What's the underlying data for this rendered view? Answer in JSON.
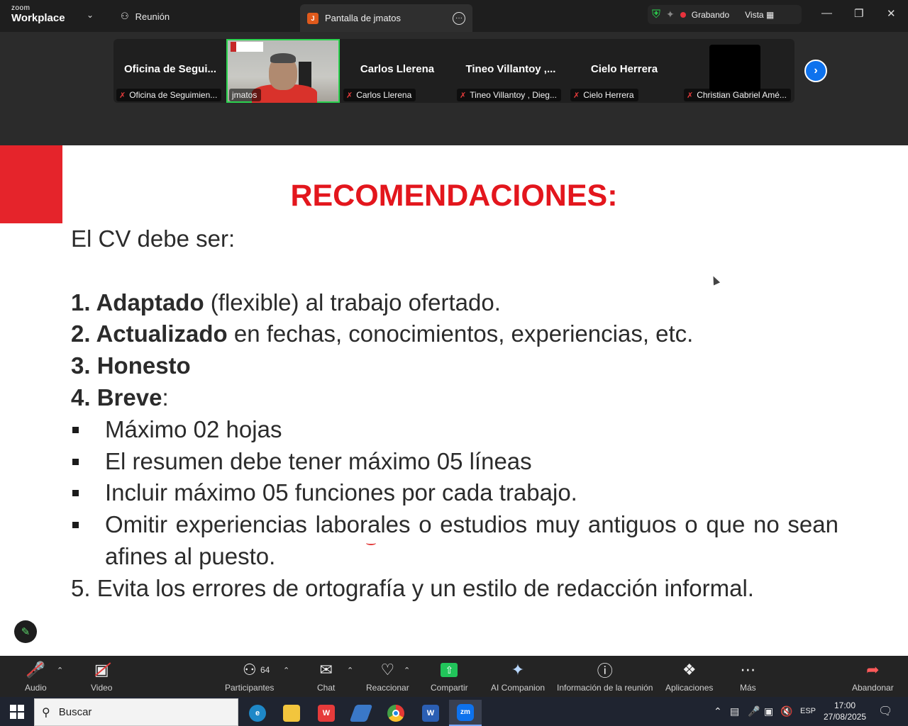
{
  "titlebar": {
    "logo_line1": "zoom",
    "logo_line2": "Workplace",
    "meeting_tab": "Reunión",
    "share_tab": "Pantalla de jmatos",
    "share_badge": "J",
    "recording": "Grabando",
    "view": "Vista"
  },
  "gallery": {
    "tiles": [
      {
        "big": "Oficina de Segui...",
        "name": "Oficina de Seguimien..."
      },
      {
        "big": "",
        "name": "jmatos"
      },
      {
        "big": "Carlos Llerena",
        "name": "Carlos Llerena"
      },
      {
        "big": "Tineo Villantoy ,...",
        "name": "Tineo Villantoy , Dieg..."
      },
      {
        "big": "Cielo Herrera",
        "name": "Cielo Herrera"
      },
      {
        "big": "",
        "name": "Christian Gabriel Amé..."
      }
    ]
  },
  "slide": {
    "title": "RECOMENDACIONES:",
    "intro": "El CV debe ser:",
    "items": [
      {
        "num": "1. ",
        "bold": "Adaptado",
        "rest": " (flexible) al trabajo ofertado."
      },
      {
        "num": "2. ",
        "bold": "Actualizado",
        "rest": " en fechas, conocimientos, experiencias, etc."
      },
      {
        "num": "3. ",
        "bold": "Honesto",
        "rest": ""
      },
      {
        "num": "4. ",
        "bold": "Breve",
        "rest": ":"
      }
    ],
    "bullets": [
      "Máximo 02 hojas",
      "El resumen debe tener máximo 05 líneas",
      "Incluir máximo 05 funciones por cada trabajo.",
      "Omitir experiencias laborales o estudios muy antiguos o que no sean afines al puesto."
    ],
    "item5": "5. Evita los errores de ortografía y un estilo de redacción informal."
  },
  "toolbar": {
    "audio": "Audio",
    "video": "Video",
    "participants": "Participantes",
    "participant_count": "64",
    "chat": "Chat",
    "react": "Reaccionar",
    "share": "Compartir",
    "ai": "AI Companion",
    "info": "Información de la reunión",
    "apps": "Aplicaciones",
    "more": "Más",
    "leave": "Abandonar"
  },
  "taskbar": {
    "search_placeholder": "Buscar",
    "lang": "ESP",
    "time": "17:00",
    "date": "27/08/2025"
  },
  "colors": {
    "accent_red": "#e3161d",
    "zoom_blue": "#0e72ed",
    "share_green": "#21c45a",
    "recording_red": "#e8323c"
  }
}
